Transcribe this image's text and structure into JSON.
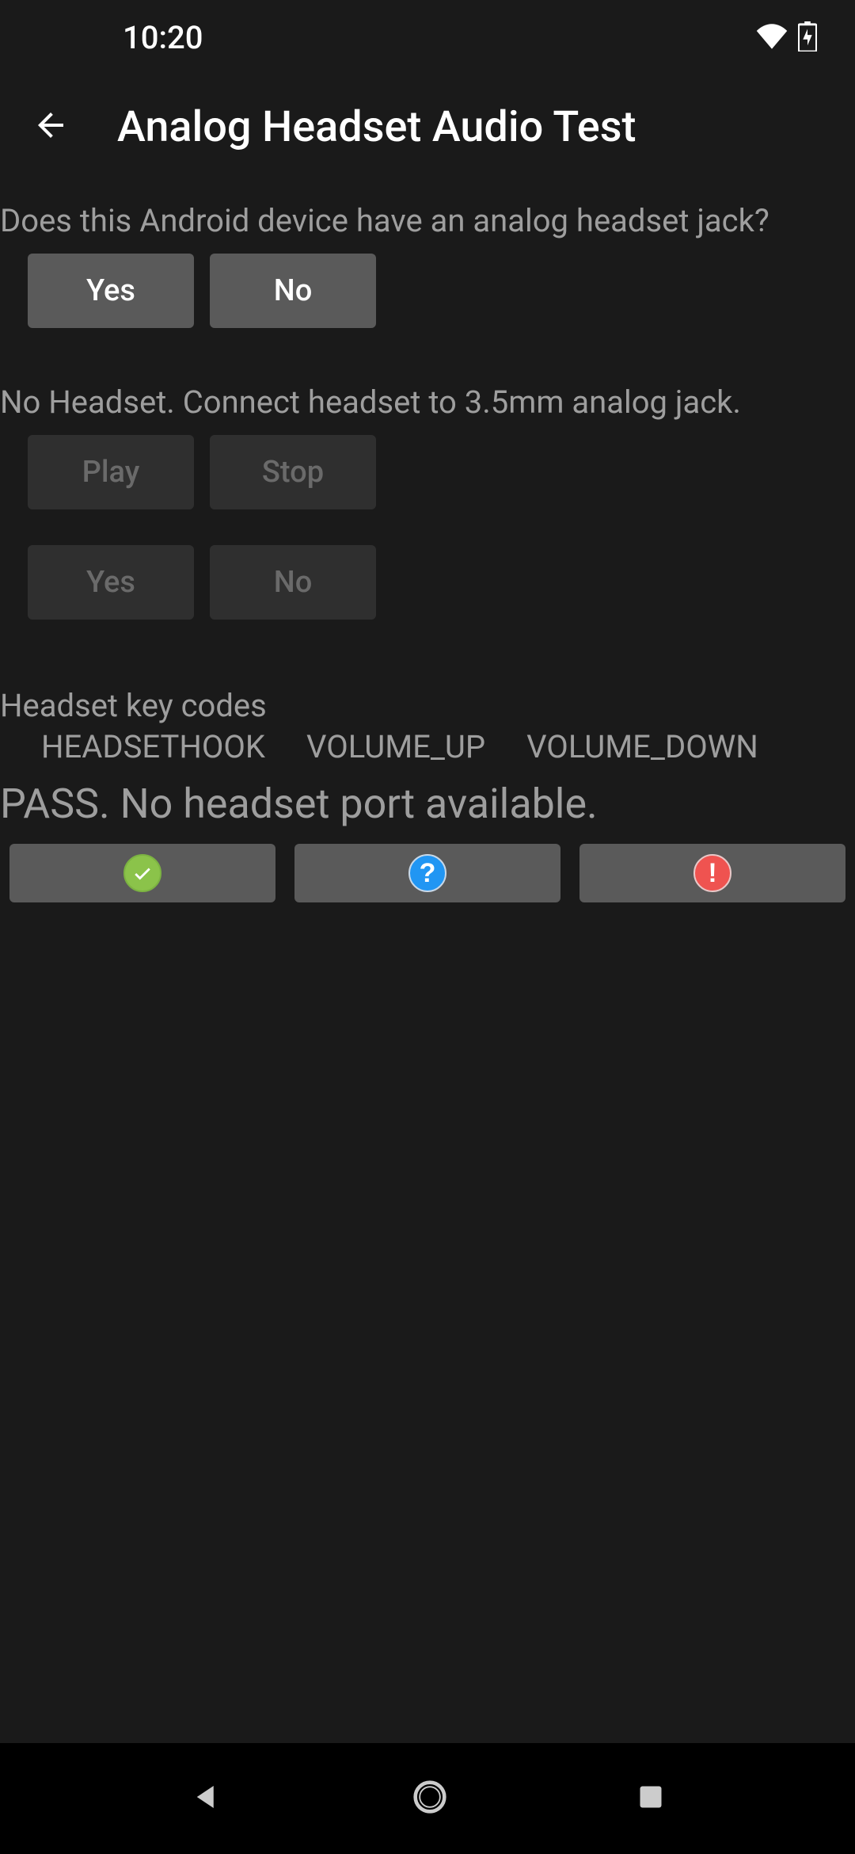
{
  "status_bar": {
    "time": "10:20"
  },
  "header": {
    "title": "Analog Headset Audio Test"
  },
  "question": "Does this Android device have an analog headset jack?",
  "question_buttons": {
    "yes": "Yes",
    "no": "No"
  },
  "headset_status": "No Headset. Connect headset to 3.5mm analog jack.",
  "playback_buttons": {
    "play": "Play",
    "stop": "Stop"
  },
  "confirm_buttons": {
    "yes": "Yes",
    "no": "No"
  },
  "keycodes": {
    "label": "Headset key codes",
    "items": [
      "HEADSETHOOK",
      "VOLUME_UP",
      "VOLUME_DOWN"
    ]
  },
  "result": "PASS. No headset port available."
}
